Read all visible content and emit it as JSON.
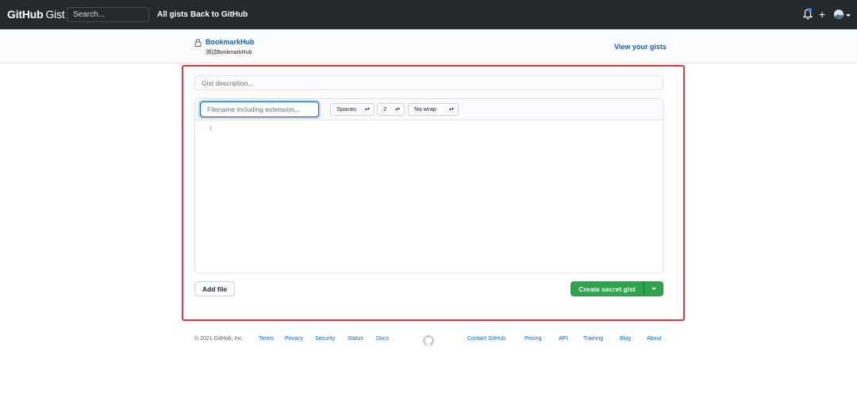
{
  "header": {
    "logo_bold": "GitHub",
    "logo_light": "Gist",
    "search_placeholder": "Search...",
    "nav": [
      "All gists",
      "Back to GitHub"
    ],
    "icons": [
      "bell-icon",
      "plus-icon",
      "avatar"
    ],
    "notification_color": "#2188ff",
    "plus_glyph": "+"
  },
  "subheader": {
    "repo_title": "BookmarkHub",
    "repo_description": "测试BookmarkHub",
    "view_gists": "View your gists"
  },
  "form": {
    "description_placeholder": "Gist description...",
    "filename_placeholder": "Filename including extension...",
    "indent_mode": "Spaces",
    "indent_size": "2",
    "wrap_mode": "No wrap",
    "line_number": "1",
    "add_file": "Add file",
    "create_button": "Create secret gist"
  },
  "footer": {
    "copyright": "© 2021 GitHub, Inc.",
    "links_left": [
      "Terms",
      "Privacy",
      "Security",
      "Status",
      "Docs"
    ],
    "links_right": [
      "Contact GitHub",
      "Pricing",
      "API",
      "Training",
      "Blog",
      "About"
    ]
  },
  "colors": {
    "header_bg": "#24292e",
    "link": "#0366d6",
    "primary_button": "#2ea44f",
    "highlight_border": "#e53935"
  }
}
